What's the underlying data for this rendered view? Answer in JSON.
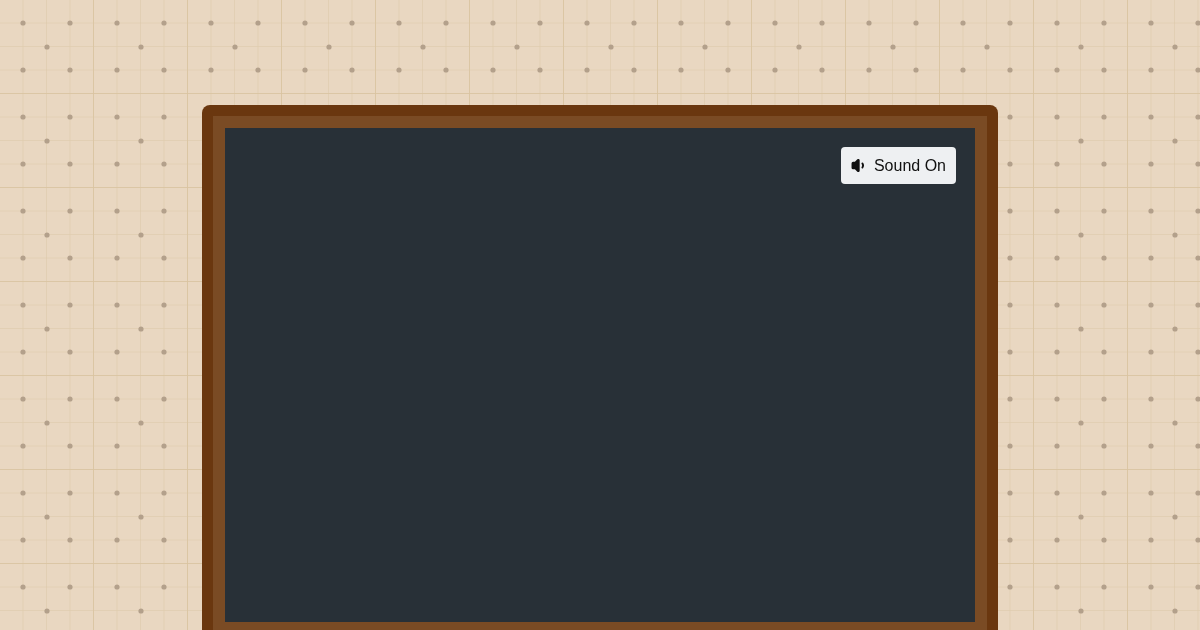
{
  "sound_button": {
    "label": "Sound On"
  }
}
